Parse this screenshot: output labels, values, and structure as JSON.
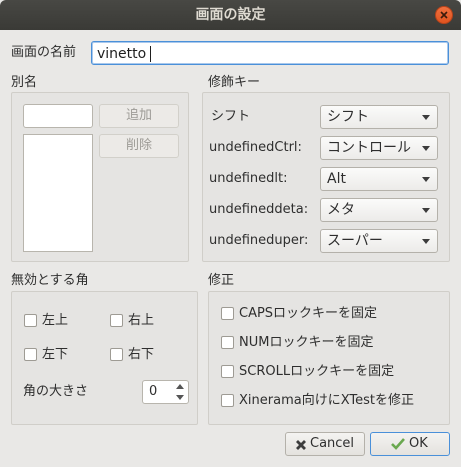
{
  "window": {
    "title": "画面の設定"
  },
  "screen_name": {
    "label": "画面の名前",
    "value": "vinetto"
  },
  "alias": {
    "section": "別名",
    "add_label": "追加",
    "delete_label": "削除",
    "input_value": "",
    "items": []
  },
  "modifiers": {
    "section": "修飾キー",
    "rows": [
      {
        "label": "シフト",
        "value": "シフト"
      },
      {
        "label": "undefinedCtrl:",
        "value": "コントロール"
      },
      {
        "label": "undefinedlt:",
        "value": "Alt"
      },
      {
        "label": "undefineddeta:",
        "value": "メタ"
      },
      {
        "label": "undefineduper:",
        "value": "スーパー"
      }
    ]
  },
  "dead_corners": {
    "section": "無効とする角",
    "top_left": "左上",
    "top_right": "右上",
    "bottom_left": "左下",
    "bottom_right": "右下",
    "size_label": "角の大きさ",
    "size_value": "0"
  },
  "fixes": {
    "section": "修正",
    "items": [
      "CAPSロックキーを固定",
      "NUMロックキーを固定",
      "SCROLLロックキーを固定",
      "Xinerama向けにXTestを修正"
    ]
  },
  "buttons": {
    "cancel": "Cancel",
    "ok": "OK"
  },
  "colors": {
    "titlebar": "#3c3b37",
    "close": "#e95420",
    "focus": "#4a90d9",
    "ok_check": "#6aa84f"
  }
}
